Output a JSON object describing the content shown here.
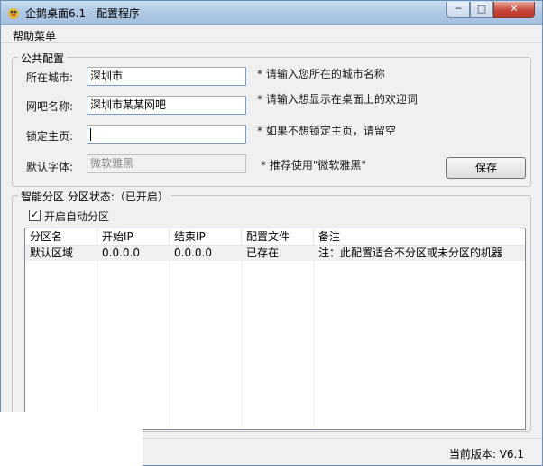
{
  "window": {
    "title": "企鹅桌面6.1 - 配置程序",
    "buttons": {
      "minimize": "─",
      "maximize": "□",
      "close": "✕"
    }
  },
  "menu": {
    "help": "帮助菜单"
  },
  "public_config": {
    "title": "公共配置",
    "city": {
      "label": "所在城市:",
      "value": "深圳市",
      "hint": "* 请输入您所在的城市名称"
    },
    "cafe": {
      "label": "网吧名称:",
      "value": "深圳市某某网吧",
      "hint": "* 请输入想显示在桌面上的欢迎词"
    },
    "homepage": {
      "label": "锁定主页:",
      "value": "",
      "hint": "* 如果不想锁定主页，请留空"
    },
    "font": {
      "label": "默认字体:",
      "value": "微软雅黑",
      "hint": "* 推荐使用\"微软雅黑\""
    },
    "save_button": "保存"
  },
  "partition": {
    "title": "智能分区 分区状态:（已开启）",
    "auto_checkbox": {
      "label": "开启自动分区",
      "checked": true
    },
    "columns": [
      "分区名",
      "开始IP",
      "结束IP",
      "配置文件",
      "备注"
    ],
    "rows": [
      {
        "name": "默认区域",
        "start_ip": "0.0.0.0",
        "end_ip": "0.0.0.0",
        "config": "已存在",
        "note": "注：此配置适合不分区或未分区的机器"
      }
    ]
  },
  "status": {
    "version": "当前版本: V6.1"
  },
  "icons": {
    "app": "penguin-app-icon",
    "check": "checkmark-icon"
  }
}
